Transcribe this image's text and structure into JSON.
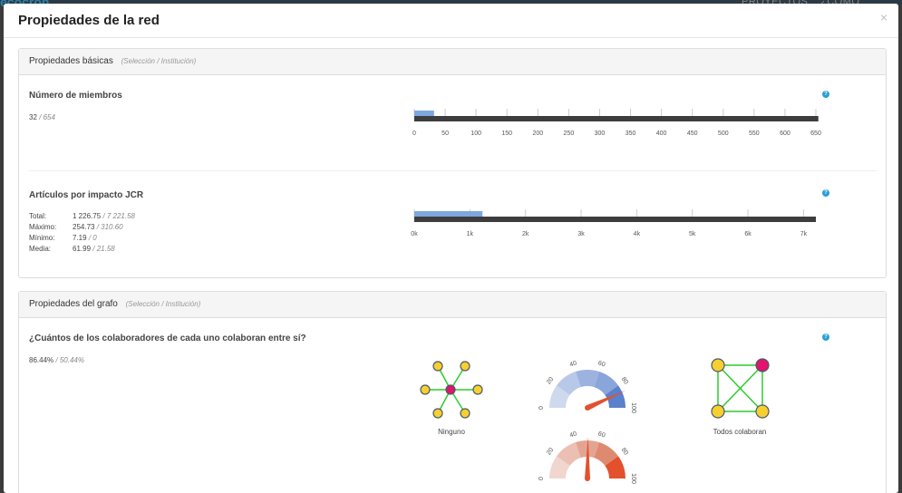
{
  "background": {
    "logo": "ecocron",
    "nav": [
      "PROYECTOS",
      "¿CÓMO FUNCIONA"
    ]
  },
  "modal": {
    "title": "Propiedades de la red",
    "close": "×"
  },
  "basic": {
    "title": "Propiedades básicas",
    "subtitle": "(Selección / Institución)",
    "members": {
      "title": "Número de miembros",
      "selection": "32",
      "institution": "/ 654",
      "help": "?",
      "selection_value": 32,
      "institution_value": 654,
      "ticks": [
        "0",
        "50",
        "100",
        "150",
        "200",
        "250",
        "300",
        "350",
        "400",
        "450",
        "500",
        "550",
        "600",
        "650"
      ]
    },
    "articles": {
      "title": "Artículos por impacto JCR",
      "help": "?",
      "rows": [
        {
          "label": "Total:",
          "value": "1 226.75",
          "inst": "/ 7 221.58"
        },
        {
          "label": "Máximo:",
          "value": "254.73",
          "inst": "/ 310.60"
        },
        {
          "label": "Mínimo:",
          "value": "7.19",
          "inst": "/ 0"
        },
        {
          "label": "Media:",
          "value": "61.99",
          "inst": "/ 21.58"
        }
      ],
      "selection_value": 1226.75,
      "institution_value": 7221.58,
      "ticks": [
        "0k",
        "1k",
        "2k",
        "3k",
        "4k",
        "5k",
        "6k",
        "7k"
      ]
    }
  },
  "graph": {
    "title": "Propiedades del grafo",
    "subtitle": "(Selección / Institución)",
    "question": "¿Cuántos de los colaboradores de cada uno colaboran entre sí?",
    "help": "?",
    "selection": "86.44%",
    "institution": "/ 50.44%",
    "selection_value": 86.44,
    "institution_value": 50.44,
    "none_label": "Ninguno",
    "all_label": "Todos colaboran",
    "gauge_ticks": [
      "0",
      "20",
      "40",
      "60",
      "80",
      "100"
    ],
    "colors": {
      "blue_gauge": [
        "#cfd9ee",
        "#b7c8e8",
        "#9db3df",
        "#8aa5da",
        "#5b80cc"
      ],
      "red_gauge": [
        "#f1d6cf",
        "#ebbfb3",
        "#e3a592",
        "#de8a70",
        "#e2512c"
      ],
      "needle": "#e2512c",
      "node_yellow": "#f7cf2f",
      "node_magenta": "#e0156b",
      "edge_green": "#2ccb2c"
    }
  },
  "colors": {
    "bar_selection": "#7ea7df",
    "bar_institution": "#3d3d3d",
    "help": "#2a9fd6"
  }
}
